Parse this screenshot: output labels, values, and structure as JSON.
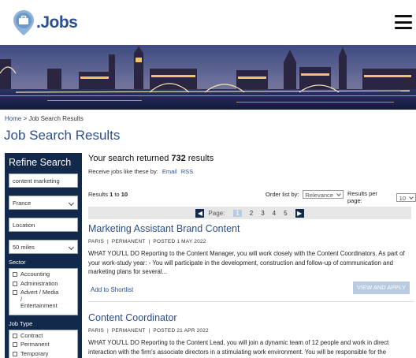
{
  "header": {
    "logo_text": ".Jobs"
  },
  "breadcrumb": {
    "home": "Home",
    "separator": " > ",
    "current": "Job Search Results"
  },
  "page_title": "Job Search Results",
  "sidebar": {
    "heading": "Refine Search",
    "keyword_value": "content marketing",
    "country_value": "France",
    "location_placeholder": "Location",
    "radius_value": "50 miles",
    "sector_label": "Sector",
    "sectors": [
      "Accounting",
      "Administration",
      "Advert / Media / Entertainment"
    ],
    "jobtype_label": "Job Type",
    "job_types": [
      "Contract",
      "Permanent",
      "Temporary"
    ]
  },
  "results": {
    "summary_prefix": "Your search returned ",
    "count": "732",
    "summary_suffix": " results",
    "alerts_label": "Receive jobs like these by:",
    "alerts_email": "Email",
    "alerts_rss": "RSS",
    "range_prefix": "Results ",
    "range_from": "1",
    "range_to_word": " to ",
    "range_to": "10",
    "order_label": "Order list by:",
    "order_value": "Relevance",
    "perpage_label": "Results per page:",
    "perpage_value": "10"
  },
  "pager": {
    "label": "Page:",
    "pages": [
      "1",
      "2",
      "3",
      "4",
      "5"
    ],
    "active": "1"
  },
  "jobs": [
    {
      "title": "Marketing Assistant Brand Content",
      "location": "PARIS",
      "type": "PERMANENT",
      "posted": "POSTED 1 MAY 2022",
      "description": "WHAT YOU'LL DO Reporting to the Content Manager, you will work closely with the Content Coordinators. As part of your work-study year: - You will participate in the development, construction and follow-up of communication and marketing plans for several...",
      "shortlist": "Add to Shortlist",
      "apply": "VIEW AND APPLY"
    },
    {
      "title": "Content Coordinator",
      "location": "PARIS",
      "type": "PERMANENT",
      "posted": "POSTED 21 APR 2022",
      "description": "WHAT YOU'LL DO Reporting to the Content Lead, you will join a dynamic team of 12 people and work in direct interaction with the firm's associate directors in a stimulating work environment. You will be responsible for the"
    }
  ]
}
